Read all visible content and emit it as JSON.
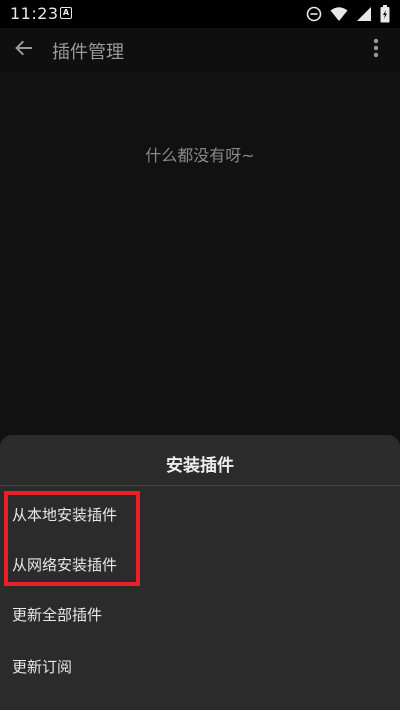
{
  "status_bar": {
    "time": "11:23",
    "app_icon_letter": "A",
    "icons": [
      "do-not-disturb-icon",
      "wifi-icon",
      "signal-icon",
      "battery-icon"
    ]
  },
  "app_bar": {
    "title": "插件管理",
    "back_icon": "back-arrow-icon",
    "more_icon": "more-vert-icon"
  },
  "main": {
    "empty_message": "什么都没有呀~"
  },
  "sheet": {
    "title": "安装插件",
    "items": [
      {
        "label": "从本地安装插件"
      },
      {
        "label": "从网络安装插件"
      },
      {
        "label": "更新全部插件"
      },
      {
        "label": "更新订阅"
      }
    ]
  },
  "colors": {
    "background": "#111111",
    "sheet": "#2b2b2b",
    "highlight": "#e8202a",
    "text": "#e8e8e8",
    "muted_text": "#8a8a8a"
  }
}
